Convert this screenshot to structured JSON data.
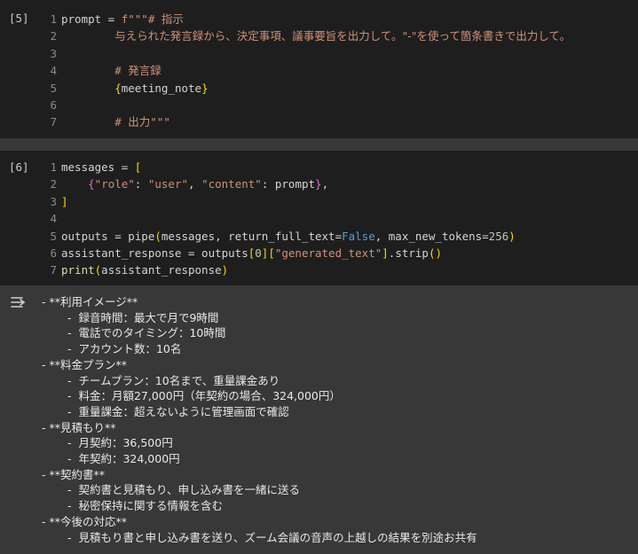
{
  "cells": [
    {
      "exec_count": "[5]",
      "lines": [
        {
          "n": "1",
          "tokens": [
            {
              "t": "prompt = ",
              "c": "k-plain"
            },
            {
              "t": "f\"\"\"# ",
              "c": "k-str"
            },
            {
              "t": "指示",
              "c": "k-str cjk"
            }
          ]
        },
        {
          "n": "2",
          "tokens": [
            {
              "t": "        ",
              "c": "k-plain"
            },
            {
              "t": "与えられた発言録から、決定事項、議事要旨を出力して。\"-\"を使って箇条書きで出力して。",
              "c": "k-str cjk"
            }
          ]
        },
        {
          "n": "3",
          "tokens": []
        },
        {
          "n": "4",
          "tokens": [
            {
              "t": "        # ",
              "c": "k-str"
            },
            {
              "t": "発言録",
              "c": "k-str cjk"
            }
          ]
        },
        {
          "n": "5",
          "tokens": [
            {
              "t": "        ",
              "c": "k-plain"
            },
            {
              "t": "{",
              "c": "k-bracket"
            },
            {
              "t": "meeting_note",
              "c": "k-plain"
            },
            {
              "t": "}",
              "c": "k-bracket"
            }
          ]
        },
        {
          "n": "6",
          "tokens": []
        },
        {
          "n": "7",
          "tokens": [
            {
              "t": "        # ",
              "c": "k-str"
            },
            {
              "t": "出力",
              "c": "k-str cjk"
            },
            {
              "t": "\"\"\"",
              "c": "k-str"
            }
          ]
        }
      ]
    },
    {
      "exec_count": "[6]",
      "lines": [
        {
          "n": "1",
          "tokens": [
            {
              "t": "messages = ",
              "c": "k-plain"
            },
            {
              "t": "[",
              "c": "k-bracket"
            }
          ]
        },
        {
          "n": "2",
          "tokens": [
            {
              "t": "    ",
              "c": "k-plain"
            },
            {
              "t": "{",
              "c": "k-bracket2"
            },
            {
              "t": "\"role\"",
              "c": "k-str"
            },
            {
              "t": ": ",
              "c": "k-plain"
            },
            {
              "t": "\"user\"",
              "c": "k-str"
            },
            {
              "t": ", ",
              "c": "k-plain"
            },
            {
              "t": "\"content\"",
              "c": "k-str"
            },
            {
              "t": ": prompt",
              "c": "k-plain"
            },
            {
              "t": "}",
              "c": "k-bracket2"
            },
            {
              "t": ",",
              "c": "k-plain"
            }
          ]
        },
        {
          "n": "3",
          "tokens": [
            {
              "t": "]",
              "c": "k-bracket"
            }
          ]
        },
        {
          "n": "4",
          "tokens": []
        },
        {
          "n": "5",
          "tokens": [
            {
              "t": "outputs = pipe",
              "c": "k-plain"
            },
            {
              "t": "(",
              "c": "k-bracket"
            },
            {
              "t": "messages, return_full_text=",
              "c": "k-plain"
            },
            {
              "t": "False",
              "c": "k-bool"
            },
            {
              "t": ", max_new_tokens=",
              "c": "k-plain"
            },
            {
              "t": "256",
              "c": "k-num"
            },
            {
              "t": ")",
              "c": "k-bracket"
            }
          ]
        },
        {
          "n": "6",
          "tokens": [
            {
              "t": "assistant_response = outputs",
              "c": "k-plain"
            },
            {
              "t": "[",
              "c": "k-bracket"
            },
            {
              "t": "0",
              "c": "k-num"
            },
            {
              "t": "]",
              "c": "k-bracket"
            },
            {
              "t": "[",
              "c": "k-bracket"
            },
            {
              "t": "\"generated_text\"",
              "c": "k-str"
            },
            {
              "t": "]",
              "c": "k-bracket"
            },
            {
              "t": ".strip",
              "c": "k-plain"
            },
            {
              "t": "()",
              "c": "k-bracket"
            }
          ]
        },
        {
          "n": "7",
          "tokens": [
            {
              "t": "print",
              "c": "k-fn"
            },
            {
              "t": "(",
              "c": "k-bracket"
            },
            {
              "t": "assistant_response",
              "c": "k-plain"
            },
            {
              "t": ")",
              "c": "k-bracket"
            }
          ]
        }
      ]
    }
  ],
  "output": {
    "icon": "output-toggle-icon",
    "lines": [
      {
        "indent": 0,
        "text": "- **利用イメージ**"
      },
      {
        "indent": 1,
        "text": "-  録音時間：最大で月で9時間"
      },
      {
        "indent": 1,
        "text": "-  電話でのタイミング：10時間"
      },
      {
        "indent": 1,
        "text": "-  アカウント数：10名"
      },
      {
        "indent": 0,
        "text": "- **料金プラン**"
      },
      {
        "indent": 1,
        "text": "-  チームプラン：10名まで、重量課金あり"
      },
      {
        "indent": 1,
        "text": "-  料金：月額27,000円（年契約の場合、324,000円）"
      },
      {
        "indent": 1,
        "text": "-  重量課金：超えないように管理画面で確認"
      },
      {
        "indent": 0,
        "text": "- **見積もり**"
      },
      {
        "indent": 1,
        "text": "-  月契約：36,500円"
      },
      {
        "indent": 1,
        "text": "-  年契約：324,000円"
      },
      {
        "indent": 0,
        "text": "- **契約書**"
      },
      {
        "indent": 1,
        "text": "-  契約書と見積もり、申し込み書を一緒に送る"
      },
      {
        "indent": 1,
        "text": "-  秘密保持に関する情報を含む"
      },
      {
        "indent": 0,
        "text": "- **今後の対応**"
      },
      {
        "indent": 1,
        "text": "-  見積もり書と申し込み書を送り、ズーム会議の音声の上越しの結果を別途お共有"
      }
    ]
  }
}
